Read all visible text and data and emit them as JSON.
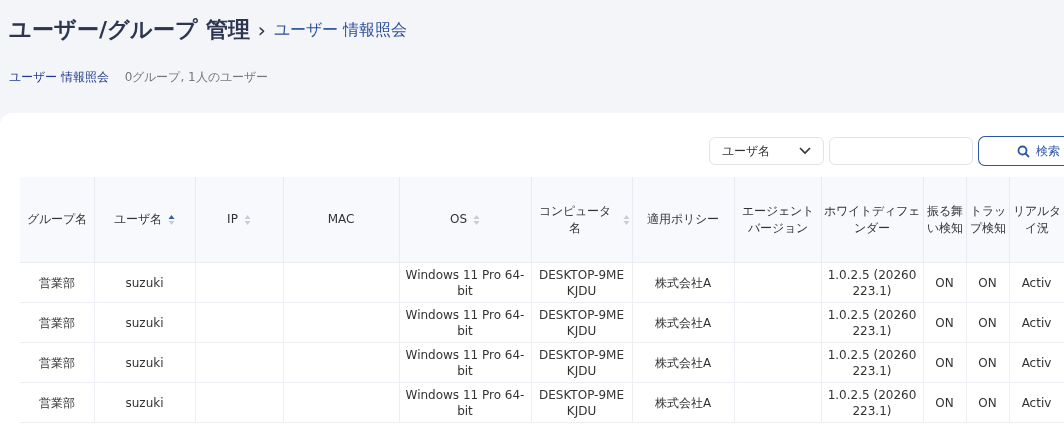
{
  "breadcrumb": {
    "title": "ユーザー/グループ 管理",
    "separator": "›",
    "current": "ユーザー 情報照会"
  },
  "subheader": {
    "label": "ユーザー 情報照会",
    "summary": "0グループ, 1人のユーザー"
  },
  "search": {
    "field_select": "ユーザ名",
    "button": "検索"
  },
  "table": {
    "columns": [
      {
        "label": "グループ名",
        "sortable": false
      },
      {
        "label": "ユーザ名",
        "sortable": true,
        "sorted_ascending": true
      },
      {
        "label": "IP",
        "sortable": true,
        "sorted_ascending": false
      },
      {
        "label": "MAC",
        "sortable": false
      },
      {
        "label": "OS",
        "sortable": true,
        "sorted_ascending": false
      },
      {
        "label": "コンピュータ名",
        "sortable": true,
        "sorted_ascending": false
      },
      {
        "label": "適用ポリシー",
        "sortable": false
      },
      {
        "label": "エージェントバージョン",
        "sortable": false
      },
      {
        "label": "ホワイトディフェンダー",
        "sortable": false
      },
      {
        "label": "振る舞い検知",
        "sortable": false
      },
      {
        "label": "トラップ検知",
        "sortable": false
      },
      {
        "label": "リアルタイ況",
        "sortable": false
      }
    ],
    "rows": [
      [
        "営業部",
        "suzuki",
        "",
        "",
        "Windows 11 Pro 64-bit",
        "DESKTOP-9MEKJDU",
        "株式会社A",
        "",
        "1.0.2.5 (20260223.1)",
        "ON",
        "ON",
        "Activ"
      ],
      [
        "営業部",
        "suzuki",
        "",
        "",
        "Windows 11 Pro 64-bit",
        "DESKTOP-9MEKJDU",
        "株式会社A",
        "",
        "1.0.2.5 (20260223.1)",
        "ON",
        "ON",
        "Activ"
      ],
      [
        "営業部",
        "suzuki",
        "",
        "",
        "Windows 11 Pro 64-bit",
        "DESKTOP-9MEKJDU",
        "株式会社A",
        "",
        "1.0.2.5 (20260223.1)",
        "ON",
        "ON",
        "Activ"
      ],
      [
        "営業部",
        "suzuki",
        "",
        "",
        "Windows 11 Pro 64-bit",
        "DESKTOP-9MEKJDU",
        "株式会社A",
        "",
        "1.0.2.5 (20260223.1)",
        "ON",
        "ON",
        "Activ"
      ]
    ]
  }
}
